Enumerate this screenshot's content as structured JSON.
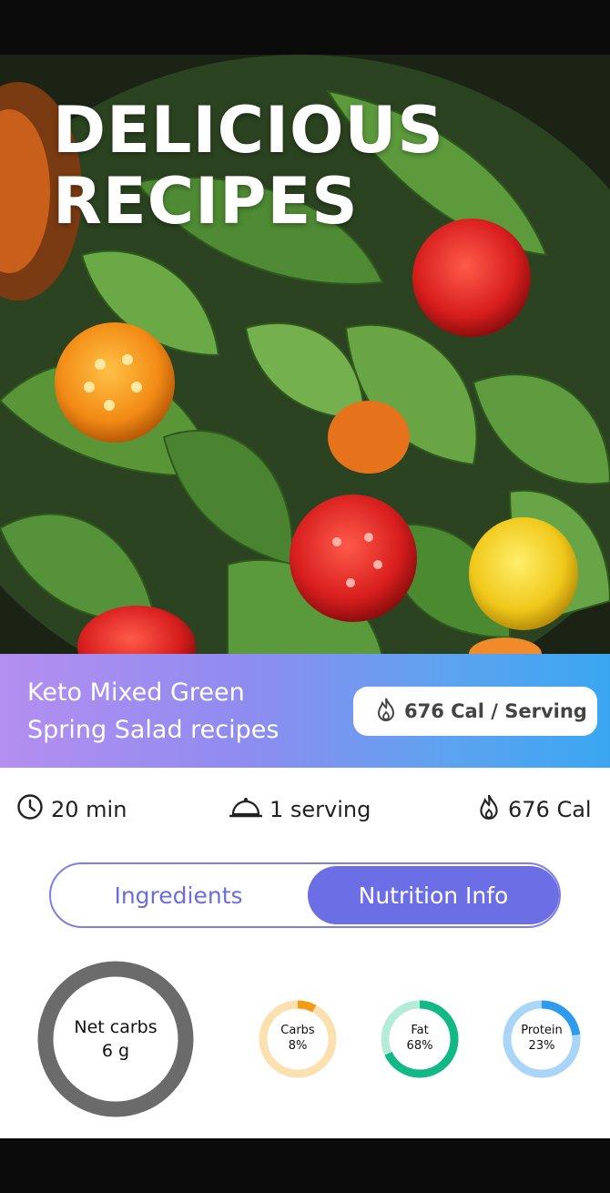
{
  "hero": {
    "title_line1": "DELICIOUS",
    "title_line2": "RECIPES",
    "image": "mixed-green-salad-photo"
  },
  "banner": {
    "recipe_name_line1": "Keto Mixed Green",
    "recipe_name_line2": "Spring Salad recipes",
    "calorie_pill": "676 Cal / Serving",
    "gradient_colors": [
      "#b48ef0",
      "#3aa6f2"
    ]
  },
  "meta": {
    "time": "20 min",
    "servings": "1 serving",
    "calories": "676 Cal",
    "icons": [
      "clock-icon",
      "cloche-icon",
      "flame-icon"
    ]
  },
  "tabs": {
    "ingredients": "Ingredients",
    "nutrition": "Nutrition Info",
    "active": "nutrition"
  },
  "nutrition": {
    "net_carbs_label": "Net carbs",
    "net_carbs_value": "6 g",
    "macros": [
      {
        "name": "Carbs",
        "percent_label": "8%",
        "fraction": 0.08,
        "color": "#f29d16",
        "track": "#fbe1b0"
      },
      {
        "name": "Fat",
        "percent_label": "68%",
        "fraction": 0.68,
        "color": "#12b886",
        "track": "#b5ecd9"
      },
      {
        "name": "Protein",
        "percent_label": "23%",
        "fraction": 0.23,
        "color": "#2f9bef",
        "track": "#a9d5f8"
      }
    ]
  },
  "colors": {
    "accent": "#6c6ee6",
    "net_carbs_ring": "#6b6b6b"
  }
}
